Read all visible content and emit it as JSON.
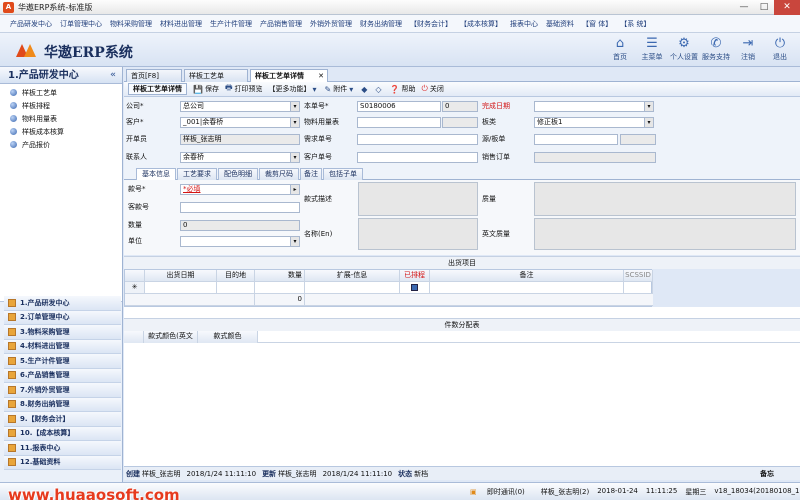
{
  "window": {
    "title": "华遨ERP系统-标准版",
    "min": "—",
    "max": "□",
    "close": "✕"
  },
  "menu": [
    "产品研发中心",
    "订单管理中心",
    "物料采购管理",
    "材料进出管理",
    "生产计件管理",
    "产品销售管理",
    "外销外贸管理",
    "财务出纳管理",
    "【财务会计】",
    "【成本核算】",
    "报表中心",
    "基础资料",
    "【窗 体】",
    "【系 统】"
  ],
  "brand": "华遨ERP系统",
  "toolicons": [
    {
      "label": "首页",
      "icon": "home-icon",
      "glyph": "⌂"
    },
    {
      "label": "主菜单",
      "icon": "menu-icon",
      "glyph": "☰"
    },
    {
      "label": "个人设置",
      "icon": "gear-icon",
      "glyph": "⚙"
    },
    {
      "label": "服务支持",
      "icon": "support-icon",
      "glyph": "✆"
    },
    {
      "label": "注销",
      "icon": "logout-icon",
      "glyph": "⇥"
    },
    {
      "label": "退出",
      "icon": "power-icon",
      "glyph": "⏻"
    }
  ],
  "sidebar": {
    "title": "1.产品研发中心",
    "collapse": "«",
    "items": [
      "样板工艺单",
      "样板排程",
      "物料用量表",
      "样板成本核算",
      "产品报价"
    ],
    "modules": [
      "1.产品研发中心",
      "2.订单管理中心",
      "3.物料采购管理",
      "4.材料进出管理",
      "5.生产计件管理",
      "6.产品销售管理",
      "7.外销外贸管理",
      "8.财务出纳管理",
      "9.【财务会计】",
      "10.【成本核算】",
      "11.报表中心",
      "12.基础资料"
    ]
  },
  "tabs": {
    "home": "首页[F8]",
    "t2": "样板工艺单",
    "t3": "样板工艺单详情",
    "close": "✕"
  },
  "toolbar": {
    "current": "样板工艺单详情",
    "save": "保存",
    "print": "打印预览",
    "more": "【更多功能】",
    "attach": "附件",
    "help": "帮助",
    "close": "关闭"
  },
  "form": {
    "company_label": "公司*",
    "company": "总公司",
    "customer_label": "客户*",
    "customer": "_001|余春桥",
    "opener_label": "开单员",
    "opener": "样板_张志明",
    "contact_label": "联系人",
    "contact": "余春桥",
    "docno_label": "本单号*",
    "docno": "S0180006",
    "docno_seq": "0",
    "material_label": "物料用量表",
    "material": "",
    "demand_label": "需求单号",
    "demand": "",
    "custorder_label": "客户单号",
    "custorder": "",
    "done_label": "完成日期",
    "done": "",
    "board_label": "板类",
    "board": "修正板1",
    "source_label": "源/板单",
    "source": "",
    "sales_label": "销售订单",
    "sales": ""
  },
  "subtabs": [
    "基本信息",
    "工艺要求",
    "配色明细",
    "裁剪尺码",
    "备注",
    "包括子单"
  ],
  "detail": {
    "style_label": "款号*",
    "style_value": "*必填",
    "custstyle_label": "客款号",
    "custstyle": "",
    "qty_label": "数量",
    "qty": "0",
    "unit_label": "单位",
    "unit": "",
    "desc_label": "款式描述",
    "name_label": "名称(En)",
    "quality_label": "质量",
    "quality_en_label": "英文质量"
  },
  "shipping": {
    "title": "出货项目",
    "headers": [
      "",
      "出货日期",
      "目的地",
      "数量",
      "扩展-信息",
      "已排程",
      "备注",
      "SCSSID"
    ],
    "row_marker": "✳",
    "total": "0"
  },
  "piece": {
    "title": "件数分配表",
    "headers": [
      "",
      "款式颜色(英文",
      "款式颜色"
    ]
  },
  "status": {
    "created_label": "创建",
    "creator": "样板_张志明",
    "created_time": "2018/1/24 11:11:10",
    "updated_label": "更新",
    "updater": "样板_张志明",
    "updated_time": "2018/1/24 11:11:10",
    "state_label": "状态",
    "state": "新档",
    "note": "备忘"
  },
  "bottom": {
    "watermark": "www.huaaosoft.com",
    "im": "即时通讯(0)",
    "user": "样板_张志明(2)",
    "date": "2018-01-24",
    "time": "11:11:25",
    "weekday": "星期三",
    "version": "v18_18034(20180108_15)"
  }
}
